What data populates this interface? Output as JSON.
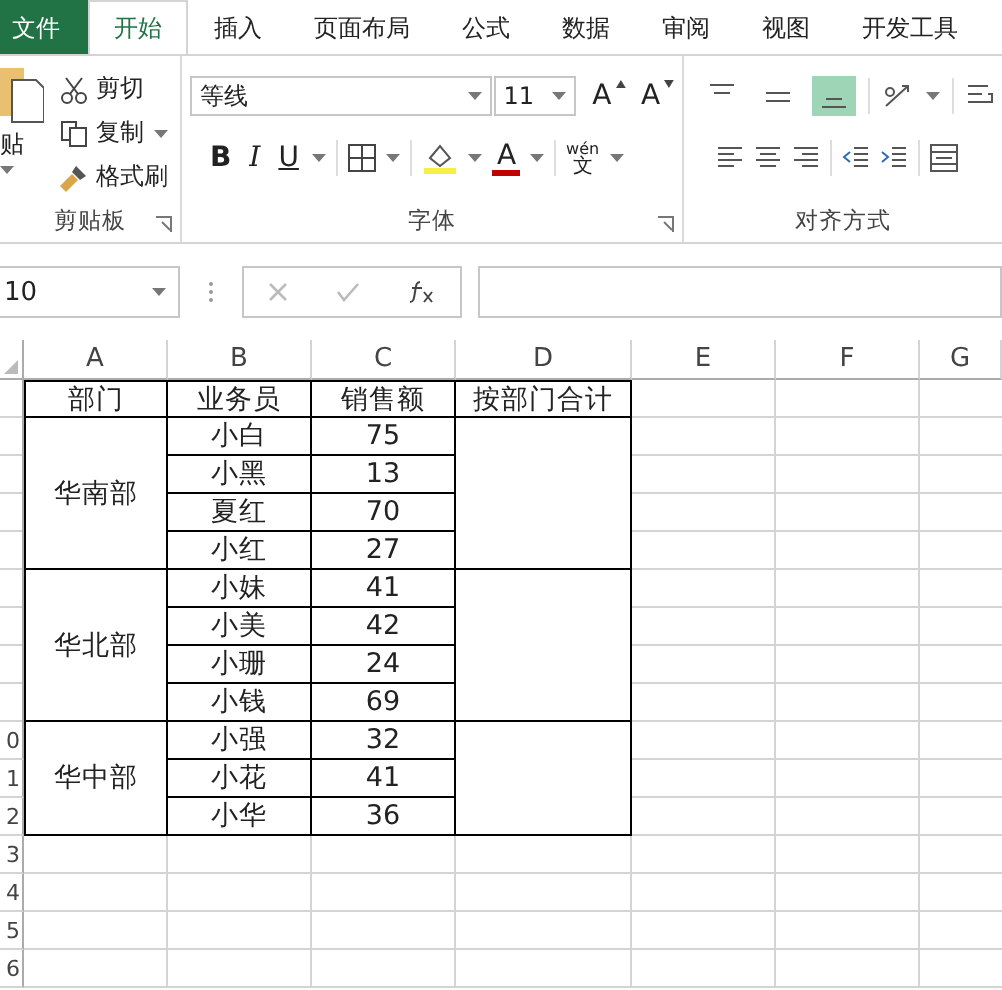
{
  "ribbon_tabs": [
    {
      "label": "文件",
      "kind": "file",
      "selected": false
    },
    {
      "label": "开始",
      "kind": "tab",
      "selected": true
    },
    {
      "label": "插入",
      "kind": "tab",
      "selected": false
    },
    {
      "label": "页面布局",
      "kind": "tab",
      "selected": false
    },
    {
      "label": "公式",
      "kind": "tab",
      "selected": false
    },
    {
      "label": "数据",
      "kind": "tab",
      "selected": false
    },
    {
      "label": "审阅",
      "kind": "tab",
      "selected": false
    },
    {
      "label": "视图",
      "kind": "tab",
      "selected": false
    },
    {
      "label": "开发工具",
      "kind": "tab",
      "selected": false
    }
  ],
  "clipboard": {
    "paste_label": "贴",
    "cut": "剪切",
    "copy": "复制",
    "format_painter": "格式刷",
    "group_label": "剪贴板"
  },
  "font": {
    "font_name": "等线",
    "font_size": "11",
    "grow": "A",
    "shrink": "A",
    "bold": "B",
    "italic": "I",
    "underline": "U",
    "font_color": "A",
    "phonetic_top": "wén",
    "phonetic_bottom": "文",
    "group_label": "字体"
  },
  "alignment": {
    "vertical": [
      {
        "kind": "top",
        "selected": false
      },
      {
        "kind": "middle",
        "selected": false
      },
      {
        "kind": "bottom",
        "selected": true
      }
    ],
    "group_label": "对齐方式"
  },
  "formula_bar": {
    "name_box": "10"
  },
  "sheet": {
    "columns": [
      "A",
      "B",
      "C",
      "D",
      "E",
      "F",
      "G"
    ],
    "row_numbers": [
      "0",
      "1",
      "2",
      "3",
      "4",
      "5",
      "6"
    ],
    "header": [
      "部门",
      "业务员",
      "销售额",
      "按部门合计"
    ],
    "groups": [
      {
        "department": "华南部",
        "members": [
          {
            "name": "小白",
            "sales": "75"
          },
          {
            "name": "小黑",
            "sales": "13"
          },
          {
            "name": "夏红",
            "sales": "70"
          },
          {
            "name": "小红",
            "sales": "27"
          }
        ]
      },
      {
        "department": "华北部",
        "members": [
          {
            "name": "小妹",
            "sales": "41"
          },
          {
            "name": "小美",
            "sales": "42"
          },
          {
            "name": "小珊",
            "sales": "24"
          },
          {
            "name": "小钱",
            "sales": "69"
          }
        ]
      },
      {
        "department": "华中部",
        "members": [
          {
            "name": "小强",
            "sales": "32"
          },
          {
            "name": "小花",
            "sales": "41"
          },
          {
            "name": "小华",
            "sales": "36"
          }
        ]
      }
    ]
  }
}
